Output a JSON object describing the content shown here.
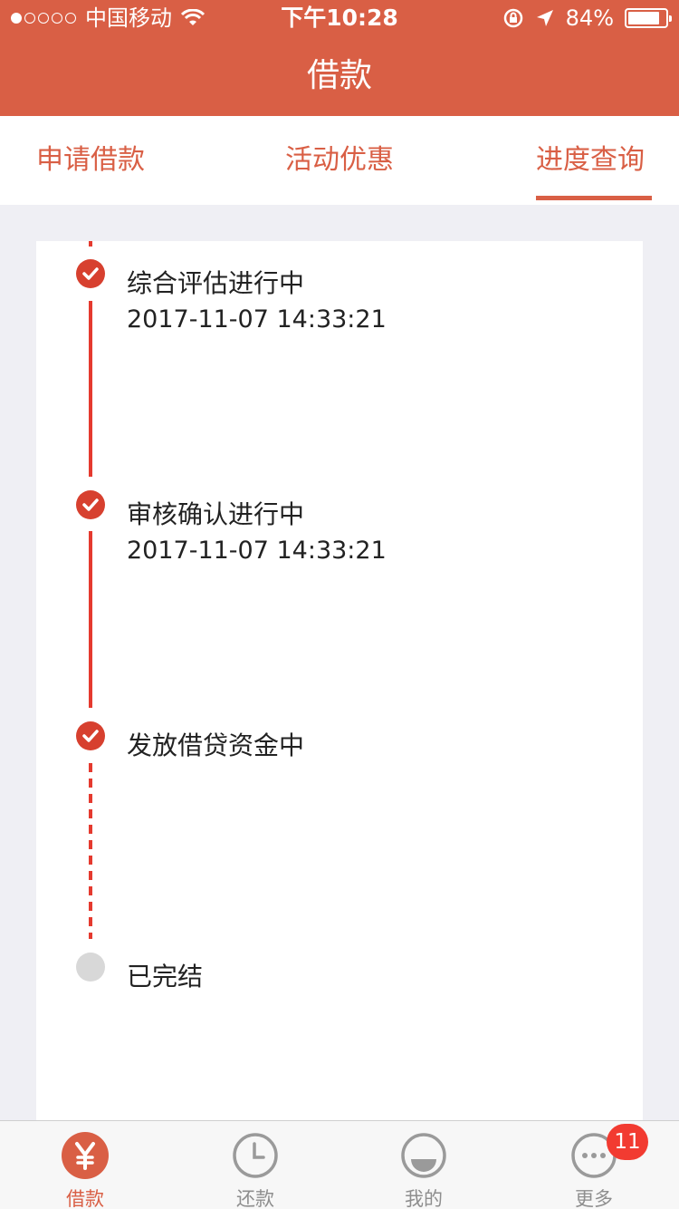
{
  "status_bar": {
    "carrier": "中国移动",
    "time": "下午10:28",
    "battery": "84%",
    "battery_level": 0.84
  },
  "nav": {
    "title": "借款"
  },
  "tabs": [
    {
      "label": "申请借款",
      "active": false
    },
    {
      "label": "活动优惠",
      "active": false
    },
    {
      "label": "进度查询",
      "active": true
    }
  ],
  "steps": [
    {
      "title": "综合评估进行中",
      "time": "2017-11-07 14:33:21",
      "status": "done"
    },
    {
      "title": "审核确认进行中",
      "time": "2017-11-07 14:33:21",
      "status": "done"
    },
    {
      "title": "发放借贷资金中",
      "time": "",
      "status": "done"
    },
    {
      "title": "已完结",
      "time": "",
      "status": "pending"
    }
  ],
  "tabbar": [
    {
      "label": "借款",
      "icon": "yen-icon",
      "active": true
    },
    {
      "label": "还款",
      "icon": "clock-icon",
      "active": false
    },
    {
      "label": "我的",
      "icon": "profile-icon",
      "active": false
    },
    {
      "label": "更多",
      "icon": "more-icon",
      "active": false
    }
  ],
  "badge": {
    "count": "11"
  },
  "colors": {
    "brand": "#d95f45",
    "timeline": "#e53a2f",
    "pending": "#d8d8d8"
  }
}
